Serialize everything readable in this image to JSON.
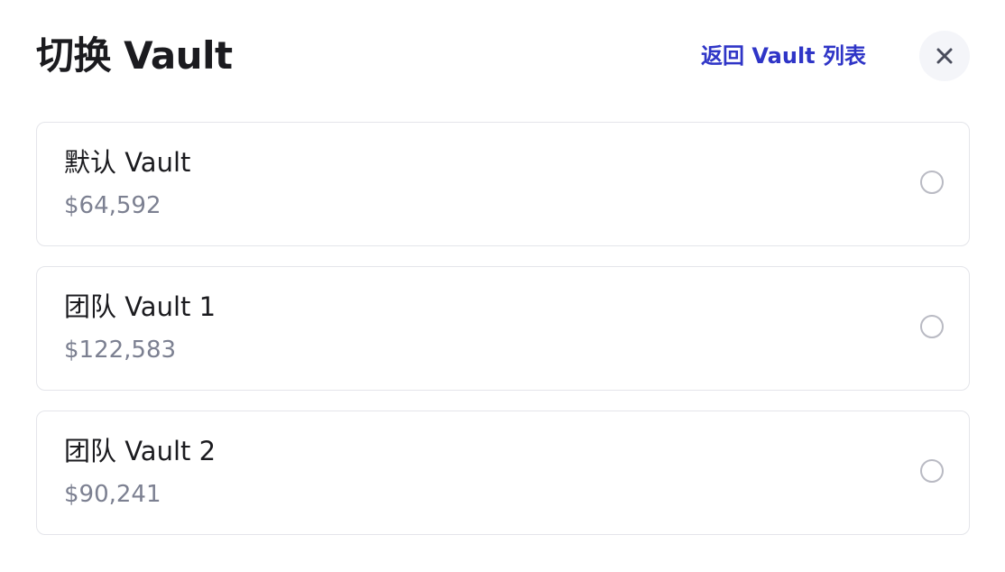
{
  "header": {
    "title": "切换 Vault",
    "back_link": "返回 Vault 列表",
    "close_icon": "close-icon"
  },
  "vaults": [
    {
      "name": "默认 Vault",
      "balance": "$64,592",
      "selected": false
    },
    {
      "name": "团队 Vault 1",
      "balance": "$122,583",
      "selected": false
    },
    {
      "name": "团队 Vault 2",
      "balance": "$90,241",
      "selected": false
    }
  ],
  "colors": {
    "accent": "#2f35c7",
    "text": "#1b1b1f",
    "muted": "#7c8091",
    "border": "#e4e5ea",
    "close_bg": "#f4f5f9",
    "radio_border": "#b9bac3"
  }
}
